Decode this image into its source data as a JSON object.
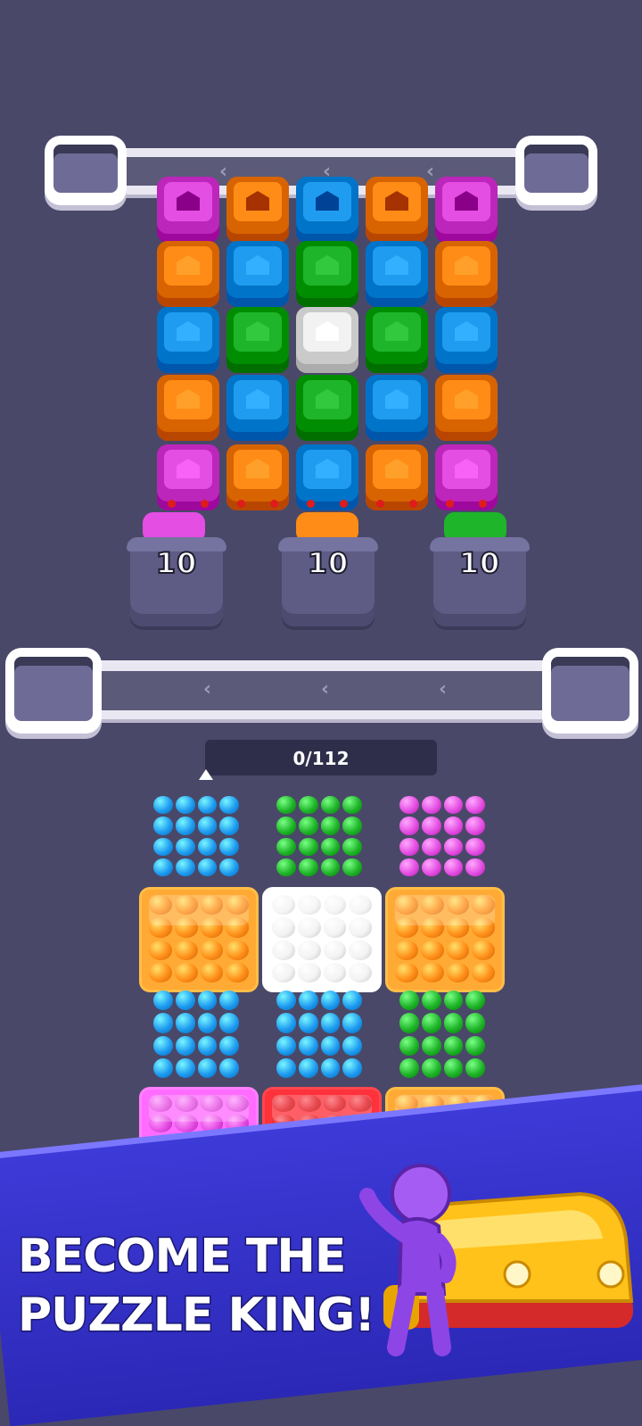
{
  "bins": [
    {
      "id": "left",
      "count": "10"
    },
    {
      "id": "middle",
      "count": "10"
    },
    {
      "id": "right",
      "count": "10"
    }
  ],
  "progress": {
    "label": "0/112"
  },
  "banner": {
    "line1": "BECOME THE",
    "line2": "PUZZLE KING!"
  },
  "colors": {
    "magenta": "#e44ee2",
    "orange": "#ff8c16",
    "blue": "#1f9cf0",
    "green": "#1fb52a",
    "white": "#f2f2f2",
    "red": "#e0141d",
    "background": "#4a4868",
    "banner": "#3331c9"
  },
  "car_grid": [
    [
      "magenta",
      "orange",
      "blue",
      "orange",
      "magenta"
    ],
    [
      "orange",
      "blue",
      "green",
      "blue",
      "orange"
    ],
    [
      "blue",
      "green",
      "white",
      "green",
      "blue"
    ],
    [
      "orange",
      "blue",
      "green",
      "blue",
      "orange"
    ],
    [
      "magenta",
      "orange",
      "blue",
      "orange",
      "magenta"
    ]
  ],
  "crates": [
    [
      "blue",
      "orange",
      "blue",
      "magenta"
    ],
    [
      "green",
      "white",
      "blue",
      "red"
    ],
    [
      "magenta",
      "orange",
      "green",
      "orange"
    ]
  ],
  "icons": [
    "chevron-left-icon",
    "mascot-character",
    "yellow-car-icon"
  ]
}
